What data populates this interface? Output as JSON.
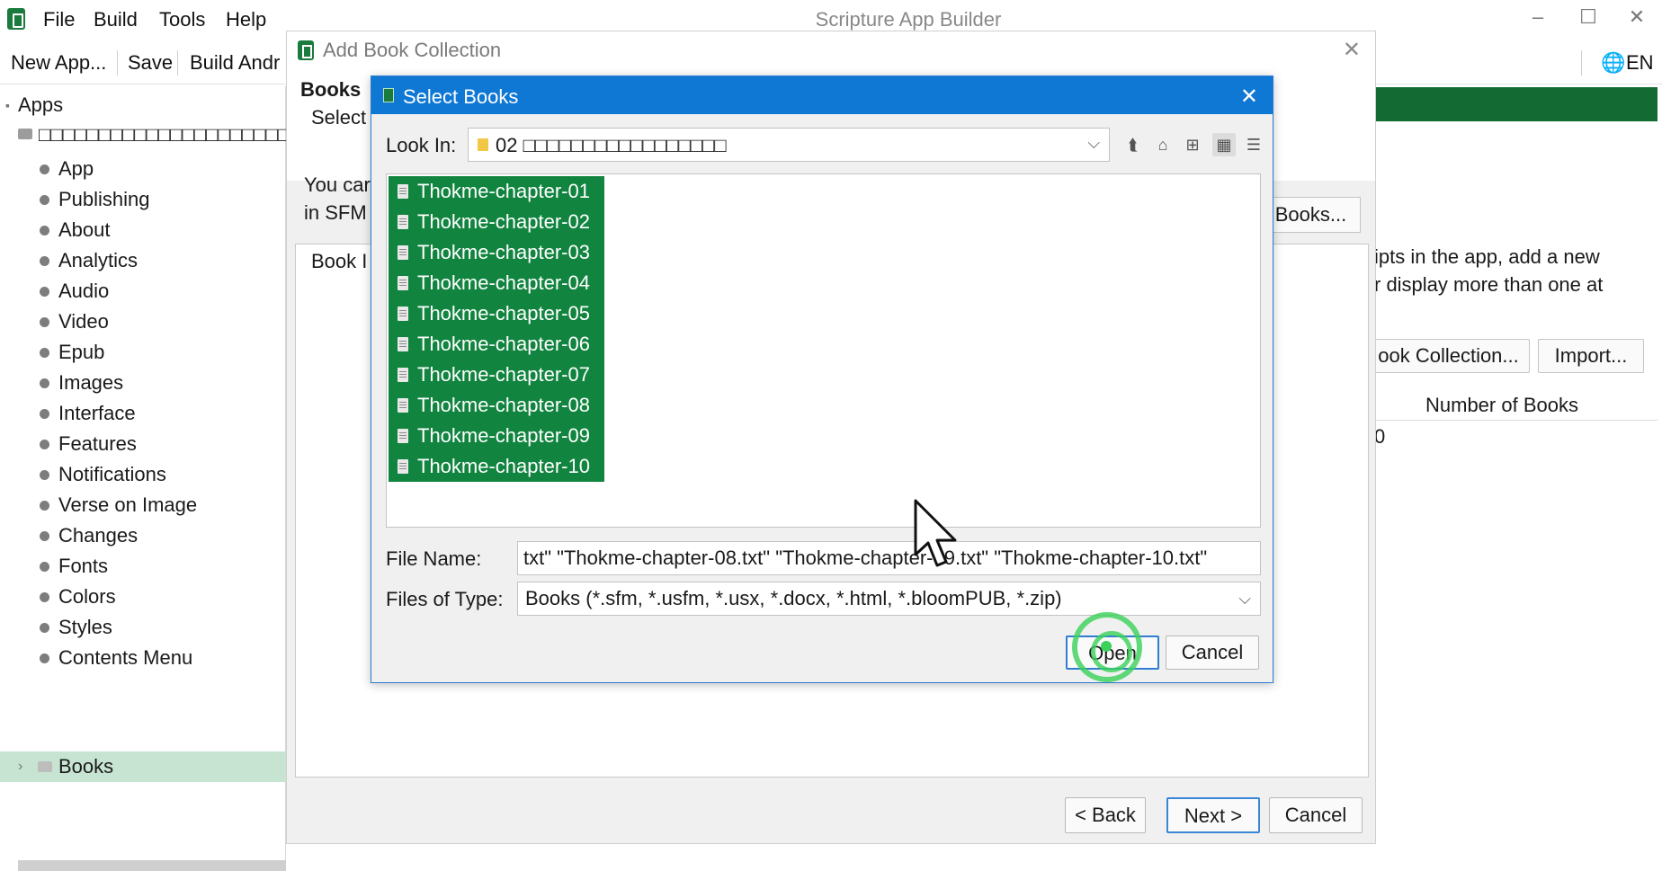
{
  "window": {
    "title": "Scripture App Builder",
    "menu": [
      "File",
      "Build",
      "Tools",
      "Help"
    ],
    "controls": {
      "minimize": "–",
      "maximize": "☐",
      "close": "✕"
    }
  },
  "toolbar": {
    "new_app": "New App...",
    "save": "Save",
    "build": "Build Andr",
    "language": "EN"
  },
  "sidebar": {
    "root": "Apps",
    "app_name": "□□□□□□□□□□□□□□□□□□□□□",
    "items": [
      "App",
      "Publishing",
      "About",
      "Analytics",
      "Audio",
      "Video",
      "Epub",
      "Images",
      "Interface",
      "Features",
      "Notifications",
      "Verse on Image",
      "Changes",
      "Fonts",
      "Colors",
      "Styles",
      "Contents Menu"
    ],
    "selected": "Books"
  },
  "background": {
    "text1": "ipts in the app, add a new",
    "text2": "r display more than one at",
    "add_collection_btn": "ook Collection...",
    "import_btn": "Import...",
    "col_number_of_books": "Number of Books",
    "row_value": "0"
  },
  "add_book_collection": {
    "title": "Add Book Collection",
    "close": "✕",
    "heading": "Books",
    "subheading": "Select",
    "desc_line1": "You car",
    "desc_line2": "in SFM",
    "books_btn": "Books...",
    "table_col": "Book I",
    "back": "< Back",
    "next": "Next >",
    "cancel": "Cancel"
  },
  "select_books": {
    "title": "Select Books",
    "close": "✕",
    "look_in_label": "Look In:",
    "look_in_value": "02 □□□□□□□□□□□□□□□□□",
    "files": [
      "Thokme-chapter-01",
      "Thokme-chapter-02",
      "Thokme-chapter-03",
      "Thokme-chapter-04",
      "Thokme-chapter-05",
      "Thokme-chapter-06",
      "Thokme-chapter-07",
      "Thokme-chapter-08",
      "Thokme-chapter-09",
      "Thokme-chapter-10"
    ],
    "file_name_label": "File Name:",
    "file_name_value": "txt\" \"Thokme-chapter-08.txt\" \"Thokme-chapter-09.txt\" \"Thokme-chapter-10.txt\"",
    "files_of_type_label": "Files of Type:",
    "files_of_type_value": "Books (*.sfm, *.usfm, *.usx, *.docx, *.html, *.bloomPUB, *.zip)",
    "open": "Open",
    "cancel": "Cancel",
    "toolbar_icons": [
      "up-folder-icon",
      "home-icon",
      "new-folder-icon",
      "list-view-icon",
      "details-view-icon"
    ]
  },
  "colors": {
    "accent_green": "#11843f",
    "title_blue": "#0f78d4",
    "click_ring": "#3ad25a"
  }
}
